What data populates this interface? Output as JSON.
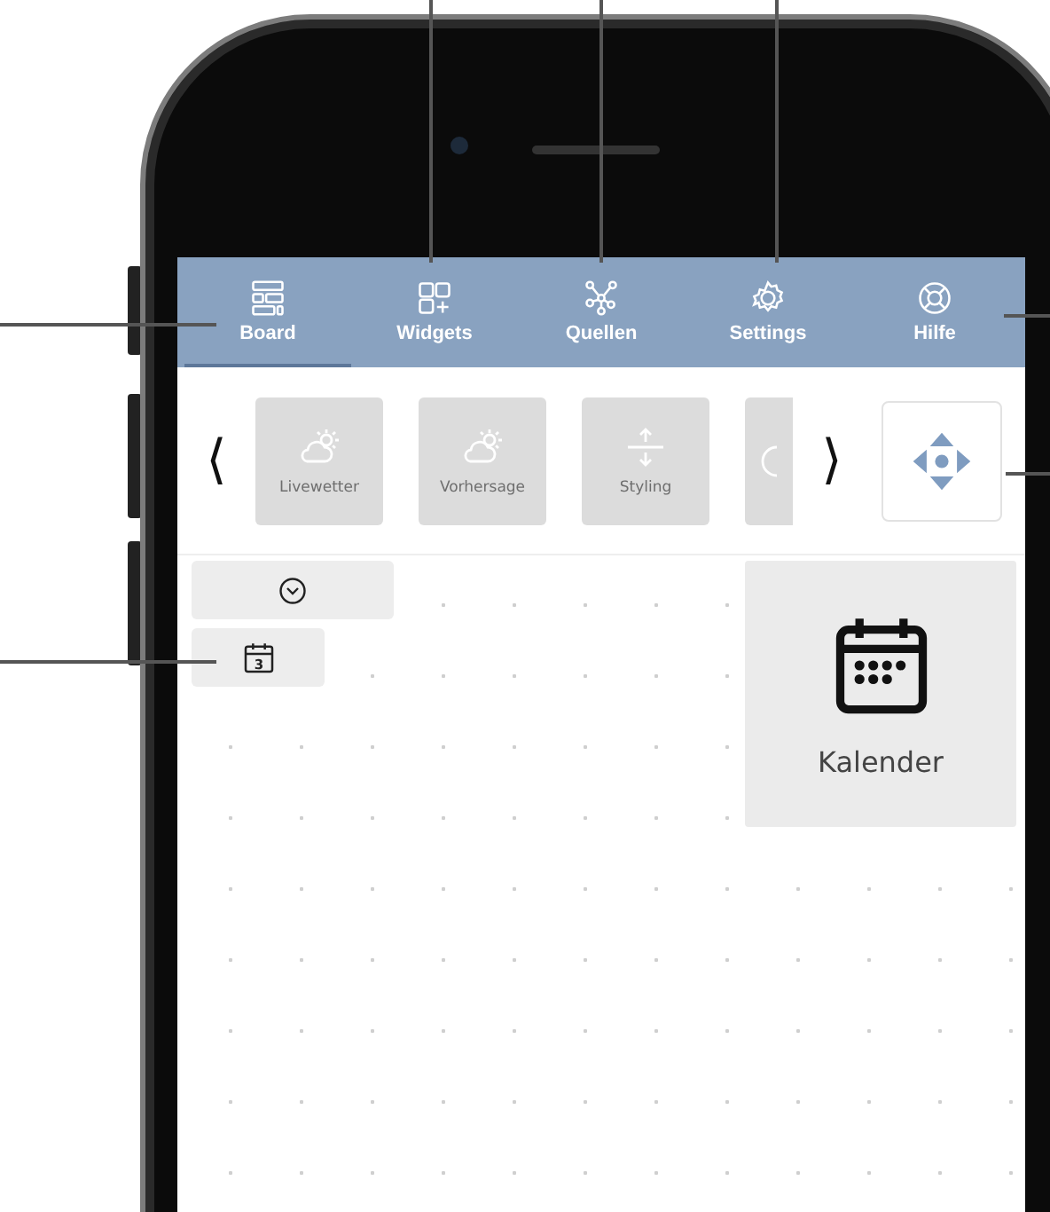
{
  "tabs": [
    {
      "label": "Board",
      "selected": true
    },
    {
      "label": "Widgets",
      "selected": false
    },
    {
      "label": "Quellen",
      "selected": false
    },
    {
      "label": "Settings",
      "selected": false
    },
    {
      "label": "Hilfe",
      "selected": false
    }
  ],
  "toolbar": {
    "prev": "⟨",
    "next": "⟩",
    "tiles": [
      {
        "label": "Livewetter",
        "kind": "weather"
      },
      {
        "label": "Vorhersage",
        "kind": "weather"
      },
      {
        "label": "Styling",
        "kind": "spacing"
      },
      {
        "kind": "partial"
      }
    ]
  },
  "board": {
    "calendar_chip": {
      "day": "3"
    },
    "panel": {
      "label": "Kalender"
    }
  }
}
